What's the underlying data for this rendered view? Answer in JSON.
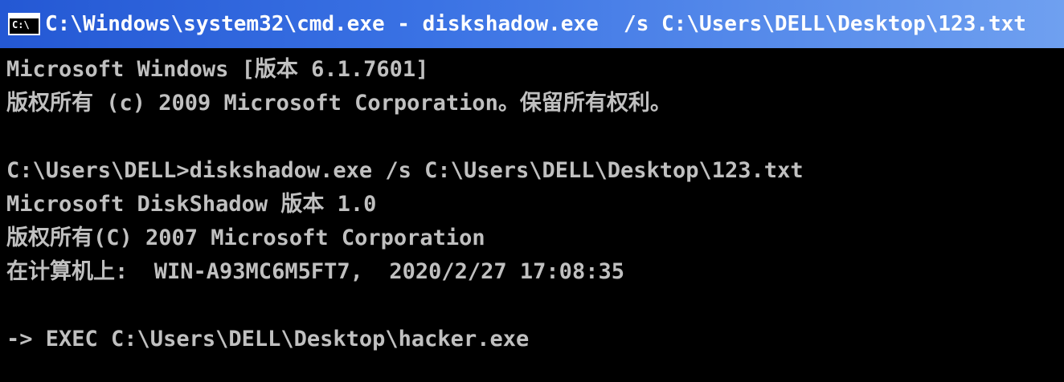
{
  "window": {
    "title": "C:\\Windows\\system32\\cmd.exe - diskshadow.exe  /s C:\\Users\\DELL\\Desktop\\123.txt",
    "icon_name": "console-icon",
    "icon_text": "C:\\"
  },
  "colors": {
    "console_background": "#000000",
    "console_text": "#c0c0c0",
    "titlebar_start": "#2458d4",
    "titlebar_end": "#6fa0f0",
    "title_text": "#ffffff"
  },
  "console": {
    "lines": [
      "Microsoft Windows [版本 6.1.7601]",
      "版权所有 (c) 2009 Microsoft Corporation。保留所有权利。",
      "",
      "C:\\Users\\DELL>diskshadow.exe /s C:\\Users\\DELL\\Desktop\\123.txt",
      "Microsoft DiskShadow 版本 1.0",
      "版权所有(C) 2007 Microsoft Corporation",
      "在计算机上:  WIN-A93MC6M5FT7,  2020/2/27 17:08:35",
      "",
      "-> EXEC C:\\Users\\DELL\\Desktop\\hacker.exe"
    ]
  }
}
